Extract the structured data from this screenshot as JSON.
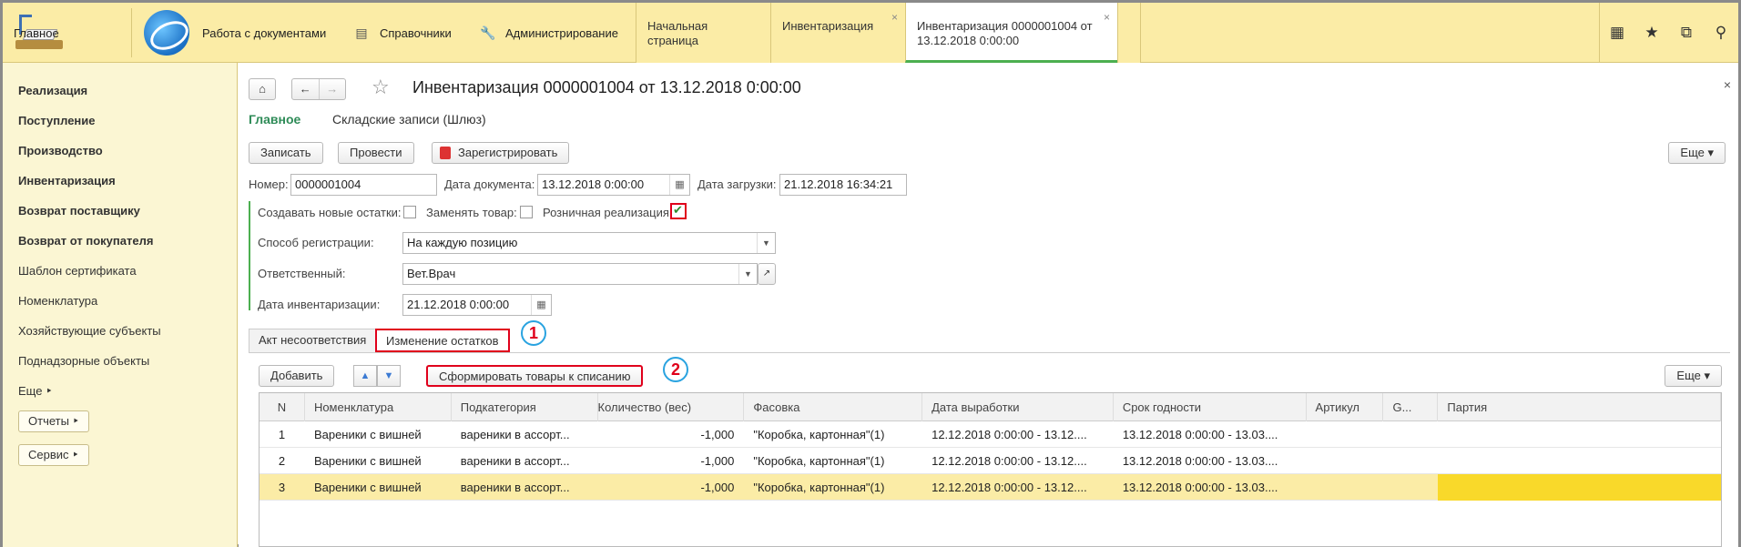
{
  "topbar": {
    "home_label": "Главное",
    "sections": [
      {
        "label": "Работа с документами",
        "icon": "globe-icon"
      },
      {
        "label": "Справочники",
        "icon": "list-icon"
      },
      {
        "label": "Администрирование",
        "icon": "wrench-icon"
      }
    ],
    "tabs": [
      {
        "label": "Начальная страница"
      },
      {
        "label": "Инвентаризация"
      },
      {
        "label_line1": "Инвентаризация 0000001004 от",
        "label_line2": "13.12.2018 0:00:00"
      }
    ],
    "right_icons": [
      "grid-icon",
      "star-icon",
      "history-icon",
      "search-icon"
    ]
  },
  "sidebar": {
    "items": [
      {
        "label": "Реализация",
        "bold": true
      },
      {
        "label": "Поступление",
        "bold": true
      },
      {
        "label": "Производство",
        "bold": true
      },
      {
        "label": "Инвентаризация",
        "bold": true
      },
      {
        "label": "Возврат поставщику",
        "bold": true
      },
      {
        "label": "Возврат от покупателя",
        "bold": true
      },
      {
        "label": "Шаблон сертификата",
        "bold": false
      },
      {
        "label": "Номенклатура",
        "bold": false
      },
      {
        "label": "Хозяйствующие субъекты",
        "bold": false
      },
      {
        "label": "Поднадзорные объекты",
        "bold": false
      },
      {
        "label": "Еще ‣",
        "bold": false
      }
    ],
    "buttons": [
      "Отчеты ‣",
      "Сервис ‣"
    ]
  },
  "form": {
    "title": "Инвентаризация 0000001004 от 13.12.2018 0:00:00",
    "subnav": {
      "main": "Главное",
      "secondary": "Складские записи (Шлюз)"
    },
    "toolbar": {
      "save": "Записать",
      "post": "Провести",
      "register": "Зарегистрировать",
      "more": "Еще ▾"
    },
    "number_label": "Номер:",
    "number_value": "0000001004",
    "doc_date_label": "Дата документа:",
    "doc_date_value": "13.12.2018  0:00:00",
    "load_date_label": "Дата загрузки:",
    "load_date_value": "21.12.2018 16:34:21",
    "create_label": "Создавать новые остатки:",
    "replace_label": "Заменять товар:",
    "retail_label": "Розничная реализация:",
    "reg_method_label": "Способ регистрации:",
    "reg_method_value": "На каждую позицию",
    "responsible_label": "Ответственный:",
    "responsible_value": "Вет.Врач",
    "inv_date_label": "Дата инвентаризации:",
    "inv_date_value": "21.12.2018  0:00:00"
  },
  "page_tabs": [
    {
      "label": "Акт несоответствия"
    },
    {
      "label": "Изменение остатков"
    }
  ],
  "badges": [
    "1",
    "2"
  ],
  "table_toolbar": {
    "add": "Добавить",
    "form": "Сформировать товары к списанию",
    "more": "Еще ▾"
  },
  "table": {
    "headers": [
      "N",
      "Номенклатура",
      "Подкатегория",
      "Количество (вес)",
      "Фасовка",
      "Дата выработки",
      "Срок годности",
      "Артикул",
      "G...",
      "Партия"
    ],
    "rows": [
      [
        "1",
        "Вареники с вишней",
        "вареники в ассорт...",
        "-1,000",
        "\"Коробка, картонная\"(1)",
        "12.12.2018 0:00:00 - 13.12....",
        "13.12.2018 0:00:00 - 13.03....",
        "",
        "",
        ""
      ],
      [
        "2",
        "Вареники с вишней",
        "вареники в ассорт...",
        "-1,000",
        "\"Коробка, картонная\"(1)",
        "12.12.2018 0:00:00 - 13.12....",
        "13.12.2018 0:00:00 - 13.03....",
        "",
        "",
        ""
      ],
      [
        "3",
        "Вареники с вишней",
        "вареники в ассорт...",
        "-1,000",
        "\"Коробка, картонная\"(1)",
        "12.12.2018 0:00:00 - 13.12....",
        "13.12.2018 0:00:00 - 13.03....",
        "",
        "",
        ""
      ]
    ]
  }
}
